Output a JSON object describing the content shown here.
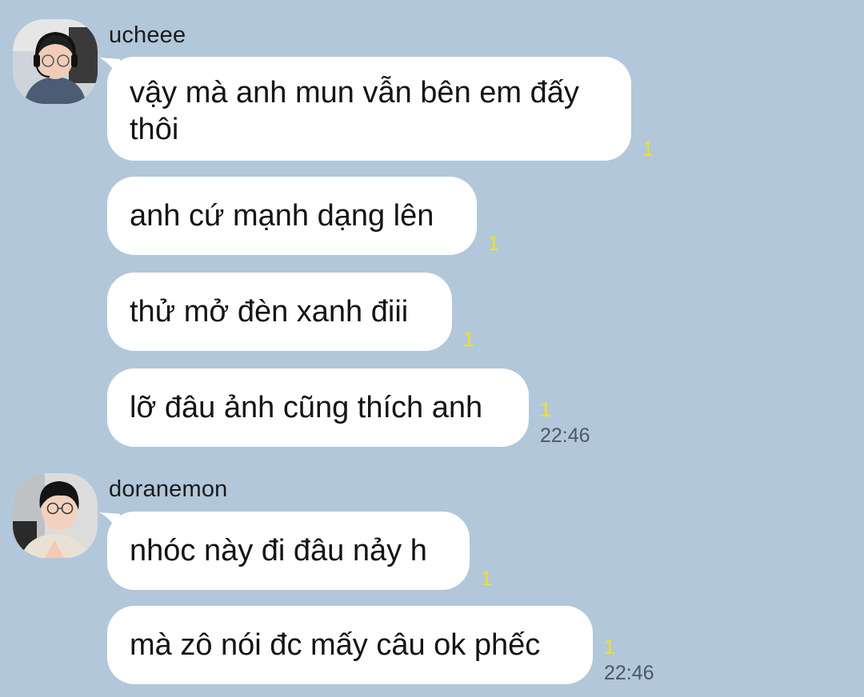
{
  "conversation": {
    "groups": [
      {
        "sender": "ucheee",
        "messages": [
          {
            "text": "vậy mà anh mun vẫn bên em đấy thôi",
            "unread": "1"
          },
          {
            "text": "anh cứ mạnh dạng lên",
            "unread": "1"
          },
          {
            "text": "thử mở đèn xanh điii",
            "unread": "1"
          },
          {
            "text": "lỡ đâu ảnh cũng thích anh",
            "unread": "1",
            "time": "22:46"
          }
        ]
      },
      {
        "sender": "doranemon",
        "messages": [
          {
            "text": "nhóc này đi đâu nảy h",
            "unread": "1"
          },
          {
            "text": "mà zô nói đc mấy câu ok phếc",
            "unread": "1",
            "time": "22:46"
          }
        ]
      }
    ]
  },
  "colors": {
    "background": "#b2c7da",
    "bubble": "#ffffff",
    "unread": "#f2e21b",
    "time": "#4d5862"
  },
  "icons": {
    "avatar_1": "person-with-glasses-headset-avatar",
    "avatar_2": "person-with-glasses-avatar"
  }
}
